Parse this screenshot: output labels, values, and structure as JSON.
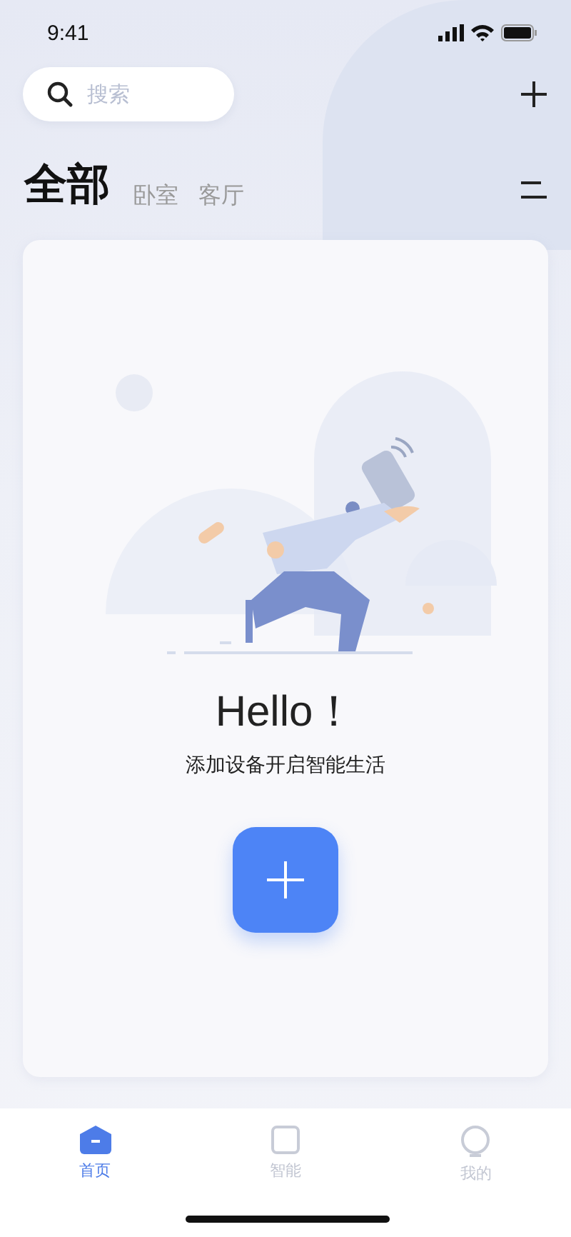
{
  "status_bar": {
    "time": "9:41"
  },
  "search": {
    "placeholder": "搜索"
  },
  "tabs": [
    {
      "label": "全部",
      "selected": true
    },
    {
      "label": "卧室",
      "selected": false
    },
    {
      "label": "客厅",
      "selected": false
    }
  ],
  "empty_state": {
    "title": "Hello！",
    "subtitle": "添加设备开启智能生活"
  },
  "nav": [
    {
      "label": "首页",
      "selected": true
    },
    {
      "label": "智能",
      "selected": false
    },
    {
      "label": "我的",
      "selected": false
    }
  ]
}
